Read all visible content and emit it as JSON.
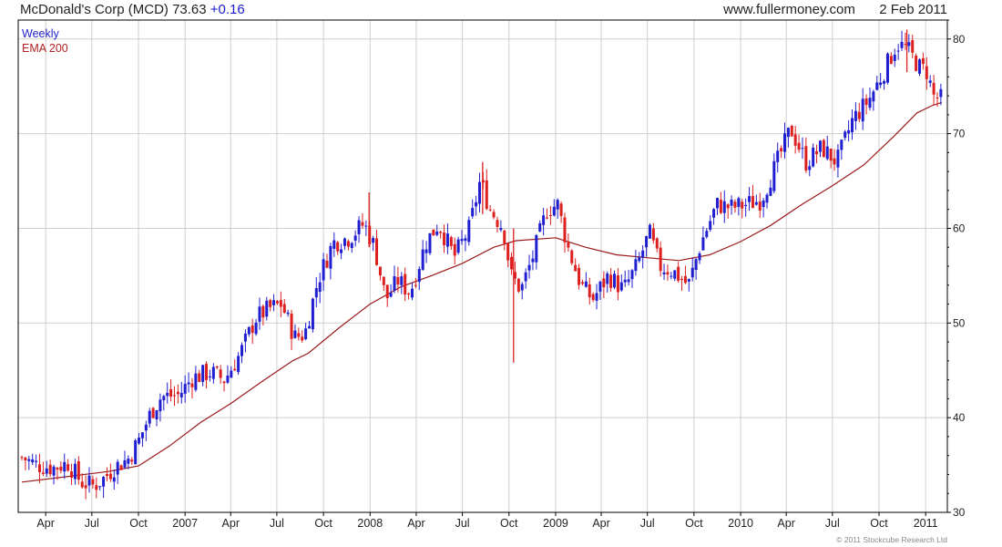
{
  "header": {
    "symbol": "McDonald's Corp (MCD)",
    "price": "73.63",
    "change": "+0.16",
    "site": "www.fullermoney.com",
    "date": "2 Feb 2011"
  },
  "legend": {
    "weekly": "Weekly",
    "ema": "EMA 200"
  },
  "copyright": "© 2011 Stockcube Research Ltd",
  "colors": {
    "up": "#1f1fd1",
    "down": "#dd1f1f",
    "ema": "#9b1a1a",
    "grid": "#cfcfcf",
    "axis": "#000000"
  },
  "chart_data": {
    "type": "candlestick",
    "frequency": "weekly",
    "ylim": [
      30,
      82
    ],
    "yticks": [
      30,
      40,
      50,
      60,
      70,
      80
    ],
    "x_start": "2006-02-13",
    "x_end": "2011-02-02",
    "xticks": [
      {
        "label": "Apr",
        "date": "2006-04-01"
      },
      {
        "label": "Jul",
        "date": "2006-07-01"
      },
      {
        "label": "Oct",
        "date": "2006-10-01"
      },
      {
        "label": "2007",
        "date": "2007-01-01"
      },
      {
        "label": "Apr",
        "date": "2007-04-01"
      },
      {
        "label": "Jul",
        "date": "2007-07-01"
      },
      {
        "label": "Oct",
        "date": "2007-10-01"
      },
      {
        "label": "2008",
        "date": "2008-01-01"
      },
      {
        "label": "Apr",
        "date": "2008-04-01"
      },
      {
        "label": "Jul",
        "date": "2008-07-01"
      },
      {
        "label": "Oct",
        "date": "2008-10-01"
      },
      {
        "label": "2009",
        "date": "2009-01-01"
      },
      {
        "label": "Apr",
        "date": "2009-04-01"
      },
      {
        "label": "Jul",
        "date": "2009-07-01"
      },
      {
        "label": "Oct",
        "date": "2009-10-01"
      },
      {
        "label": "2010",
        "date": "2010-01-01"
      },
      {
        "label": "Apr",
        "date": "2010-04-01"
      },
      {
        "label": "Jul",
        "date": "2010-07-01"
      },
      {
        "label": "Oct",
        "date": "2010-10-01"
      },
      {
        "label": "2011",
        "date": "2011-01-01"
      }
    ],
    "close_path": [
      [
        "2006-02-13",
        35.8
      ],
      [
        "2006-03-15",
        35.0
      ],
      [
        "2006-04-15",
        34.7
      ],
      [
        "2006-05-15",
        35.2
      ],
      [
        "2006-06-10",
        33.2
      ],
      [
        "2006-07-05",
        32.8
      ],
      [
        "2006-07-25",
        33.6
      ],
      [
        "2006-08-15",
        34.8
      ],
      [
        "2006-09-10",
        35.6
      ],
      [
        "2006-10-01",
        37.5
      ],
      [
        "2006-10-25",
        40.5
      ],
      [
        "2006-11-15",
        42.2
      ],
      [
        "2006-12-20",
        42.4
      ],
      [
        "2007-01-15",
        44.2
      ],
      [
        "2007-02-20",
        44.8
      ],
      [
        "2007-03-20",
        44.0
      ],
      [
        "2007-04-20",
        46.8
      ],
      [
        "2007-05-20",
        50.5
      ],
      [
        "2007-06-15",
        51.5
      ],
      [
        "2007-07-10",
        52.0
      ],
      [
        "2007-08-05",
        48.5
      ],
      [
        "2007-08-25",
        48.8
      ],
      [
        "2007-09-20",
        54.5
      ],
      [
        "2007-10-20",
        58.5
      ],
      [
        "2007-11-20",
        59.0
      ],
      [
        "2007-12-20",
        60.5
      ],
      [
        "2008-01-10",
        58.0
      ],
      [
        "2008-02-01",
        52.5
      ],
      [
        "2008-02-25",
        54.5
      ],
      [
        "2008-03-20",
        53.2
      ],
      [
        "2008-04-20",
        58.5
      ],
      [
        "2008-05-15",
        60.5
      ],
      [
        "2008-06-15",
        57.0
      ],
      [
        "2008-07-15",
        60.0
      ],
      [
        "2008-08-05",
        65.0
      ],
      [
        "2008-08-25",
        62.0
      ],
      [
        "2008-09-20",
        60.0
      ],
      [
        "2008-10-05",
        55.0
      ],
      [
        "2008-10-25",
        53.5
      ],
      [
        "2008-11-20",
        57.5
      ],
      [
        "2008-12-15",
        62.0
      ],
      [
        "2009-01-05",
        62.5
      ],
      [
        "2009-01-25",
        58.0
      ],
      [
        "2009-02-20",
        54.0
      ],
      [
        "2009-03-15",
        52.5
      ],
      [
        "2009-04-15",
        55.0
      ],
      [
        "2009-05-15",
        53.5
      ],
      [
        "2009-06-10",
        56.0
      ],
      [
        "2009-07-05",
        59.5
      ],
      [
        "2009-07-25",
        56.0
      ],
      [
        "2009-08-20",
        55.5
      ],
      [
        "2009-09-20",
        54.0
      ],
      [
        "2009-10-15",
        58.5
      ],
      [
        "2009-11-15",
        62.5
      ],
      [
        "2009-12-15",
        62.2
      ],
      [
        "2010-01-10",
        62.5
      ],
      [
        "2010-02-10",
        63.0
      ],
      [
        "2010-03-10",
        66.5
      ],
      [
        "2010-04-10",
        70.5
      ],
      [
        "2010-05-10",
        67.0
      ],
      [
        "2010-06-10",
        68.5
      ],
      [
        "2010-07-10",
        67.0
      ],
      [
        "2010-08-10",
        71.5
      ],
      [
        "2010-09-10",
        73.5
      ],
      [
        "2010-10-10",
        76.5
      ],
      [
        "2010-11-05",
        79.5
      ],
      [
        "2010-11-25",
        79.0
      ],
      [
        "2010-12-20",
        77.0
      ],
      [
        "2011-01-05",
        76.5
      ],
      [
        "2011-01-15",
        74.0
      ],
      [
        "2011-02-02",
        73.63
      ]
    ],
    "ema_200": [
      [
        "2006-02-13",
        33.2
      ],
      [
        "2006-05-01",
        33.7
      ],
      [
        "2006-08-01",
        34.3
      ],
      [
        "2006-10-01",
        34.9
      ],
      [
        "2006-12-01",
        37.0
      ],
      [
        "2007-02-01",
        39.5
      ],
      [
        "2007-04-01",
        41.5
      ],
      [
        "2007-06-01",
        43.8
      ],
      [
        "2007-08-01",
        46.0
      ],
      [
        "2007-09-01",
        46.8
      ],
      [
        "2007-11-01",
        49.5
      ],
      [
        "2008-01-01",
        52.0
      ],
      [
        "2008-03-01",
        53.8
      ],
      [
        "2008-05-01",
        55.0
      ],
      [
        "2008-07-01",
        56.3
      ],
      [
        "2008-09-01",
        58.0
      ],
      [
        "2008-10-15",
        58.7
      ],
      [
        "2009-01-01",
        59.0
      ],
      [
        "2009-03-01",
        58.0
      ],
      [
        "2009-05-01",
        57.2
      ],
      [
        "2009-07-01",
        56.9
      ],
      [
        "2009-09-01",
        56.6
      ],
      [
        "2009-11-01",
        57.2
      ],
      [
        "2010-01-01",
        58.6
      ],
      [
        "2010-03-01",
        60.3
      ],
      [
        "2010-05-01",
        62.5
      ],
      [
        "2010-07-01",
        64.5
      ],
      [
        "2010-09-01",
        66.7
      ],
      [
        "2010-11-01",
        69.8
      ],
      [
        "2010-12-15",
        72.2
      ],
      [
        "2011-01-15",
        73.0
      ],
      [
        "2011-02-02",
        73.3
      ]
    ],
    "spikes": [
      {
        "date": "2008-10-10",
        "low": 45.8,
        "high": 60.0
      },
      {
        "date": "2007-12-30",
        "low": 58.0,
        "high": 63.8
      },
      {
        "date": "2008-08-10",
        "low": 61.5,
        "high": 67.0
      },
      {
        "date": "2010-11-25",
        "low": 76.5,
        "high": 81.0
      }
    ]
  }
}
